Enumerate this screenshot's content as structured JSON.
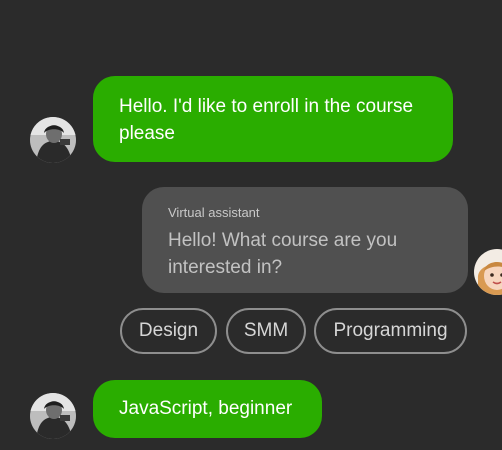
{
  "messages": {
    "user_1": "Hello. I'd like to enroll in the course please",
    "bot_sender": "Virtual assistant",
    "bot_1": "Hello! What course are you interested in?",
    "user_2": "JavaScript, beginner"
  },
  "quick_replies": [
    "Design",
    "SMM",
    "Programming"
  ],
  "colors": {
    "background": "#2b2b2b",
    "user_bubble": "#2aad00",
    "bot_bubble": "#505050",
    "chip_border": "#8e8e8e"
  },
  "icons": {
    "user_avatar": "user-avatar-photo",
    "bot_avatar": "assistant-avatar-illustration"
  }
}
